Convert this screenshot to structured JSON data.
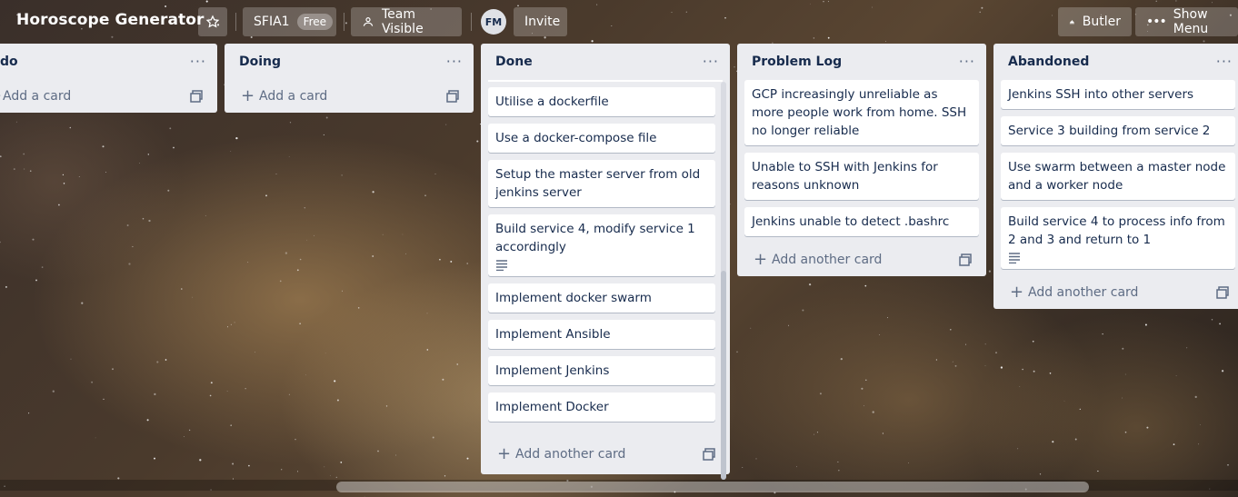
{
  "header": {
    "title": "Horoscope Generator",
    "workspace": "SFIA1",
    "workspace_plan": "Free",
    "visibility": "Team Visible",
    "member_initials": "FM",
    "invite": "Invite",
    "butler": "Butler",
    "show_menu": "Show Menu"
  },
  "lists": {
    "todo": {
      "title": "do",
      "add_label": "Add a card"
    },
    "doing": {
      "title": "Doing",
      "add_label": "Add a card"
    },
    "done": {
      "title": "Done",
      "cards": [
        "Utilise a dockerfile",
        "Use a docker-compose file",
        "Setup the master server from old jenkins server",
        "Build service 4, modify service 1 accordingly",
        "Implement docker swarm",
        "Implement Ansible",
        "Implement Jenkins",
        "Implement Docker"
      ],
      "add_label": "Add another card"
    },
    "problem": {
      "title": "Problem Log",
      "cards": [
        "GCP increasingly unreliable as more people work from home. SSH no longer reliable",
        "Unable to SSH with Jenkins for reasons unknown",
        "Jenkins unable to detect .bashrc"
      ],
      "add_label": "Add another card"
    },
    "abandoned": {
      "title": "Abandoned",
      "cards": [
        "Jenkins SSH into other servers",
        "Service 3 building from service 2",
        "Use swarm between a master node and a worker node",
        "Build service 4 to process info from 2 and 3 and return to 1"
      ],
      "add_label": "Add another card"
    }
  },
  "icons": {
    "star": "star-icon",
    "visibility": "team-visibility-icon",
    "butler": "butler-bell-icon",
    "menu": "more-dots-icon",
    "list_menu": "list-menu-icon",
    "description": "description-icon",
    "template": "card-template-icon",
    "add": "plus-icon"
  },
  "colors": {
    "list_bg": "#ebecf0",
    "card_bg": "#ffffff",
    "text": "#172b4d",
    "muted": "#5e6c84"
  }
}
